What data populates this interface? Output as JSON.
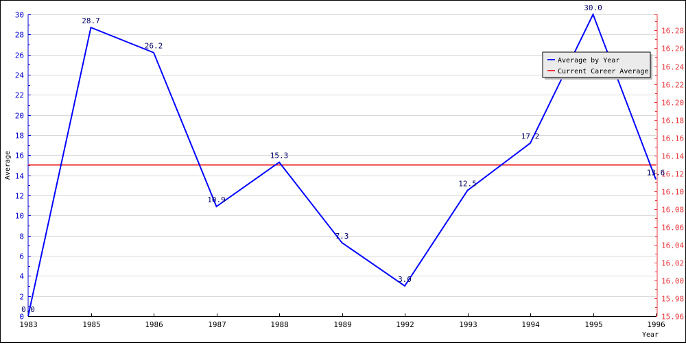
{
  "chart_data": {
    "type": "line",
    "title": "",
    "xlabel": "Year",
    "ylabel": "Average",
    "categories": [
      "1983",
      "1985",
      "1986",
      "1987",
      "1988",
      "1989",
      "1992",
      "1993",
      "1994",
      "1995",
      "1996"
    ],
    "series": [
      {
        "name": "Average by Year",
        "axis": "left",
        "color": "#0000ff",
        "values": [
          0.0,
          28.7,
          26.2,
          10.9,
          15.3,
          7.3,
          3.0,
          12.5,
          17.2,
          30.0,
          13.6
        ],
        "labels": [
          "0.0",
          "28.7",
          "26.2",
          "10.9",
          "15.3",
          "7.3",
          "3.0",
          "12.5",
          "17.2",
          "30.0",
          "13.6"
        ]
      },
      {
        "name": "Current Career Average",
        "axis": "right",
        "color": "#ee3333",
        "value": 16.13
      }
    ],
    "left_axis": {
      "ylim": [
        0,
        30
      ],
      "ticks": [
        "0",
        "2",
        "4",
        "6",
        "8",
        "10",
        "12",
        "14",
        "16",
        "18",
        "20",
        "22",
        "24",
        "26",
        "28",
        "30"
      ],
      "color": "#0000cc"
    },
    "right_axis": {
      "ylim": [
        15.96,
        16.298
      ],
      "ticks": [
        "15.96",
        "15.98",
        "16.00",
        "16.02",
        "16.04",
        "16.06",
        "16.08",
        "16.10",
        "16.12",
        "16.14",
        "16.16",
        "16.18",
        "16.20",
        "16.22",
        "16.24",
        "16.26",
        "16.28"
      ],
      "color": "#e8383d"
    },
    "grid": true,
    "legend": {
      "position": "top-right",
      "entries": [
        "Average by Year",
        "Current Career Average"
      ]
    }
  }
}
